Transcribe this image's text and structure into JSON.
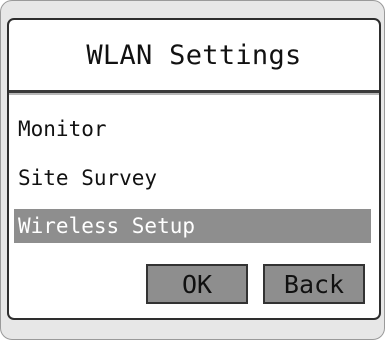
{
  "dialog": {
    "title": "WLAN Settings"
  },
  "menu": {
    "items": [
      {
        "label": "Monitor",
        "selected": false
      },
      {
        "label": "Site Survey",
        "selected": false
      },
      {
        "label": "Wireless Setup",
        "selected": true
      }
    ]
  },
  "buttons": {
    "ok_label": "OK",
    "back_label": "Back"
  },
  "colors": {
    "selection_background": "#8e8e8e",
    "selection_text": "#ffffff",
    "button_background": "#8e8e8e",
    "frame_background": "#e7e7e7",
    "screen_background": "#ffffff"
  }
}
